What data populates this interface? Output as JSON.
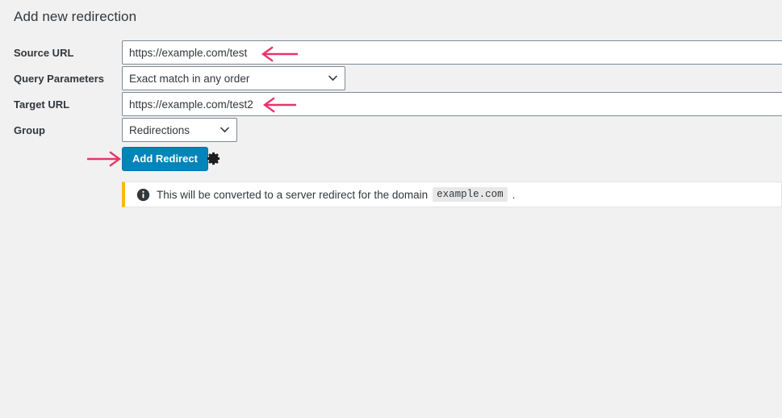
{
  "page": {
    "title": "Add new redirection",
    "background_color": "#f1f1f1"
  },
  "form": {
    "rows": [
      {
        "label": "Source URL",
        "type": "text",
        "value": "https://example.com/test",
        "placeholder": ""
      },
      {
        "label": "Query Parameters",
        "type": "select",
        "value": "Exact match in any order"
      },
      {
        "label": "Target URL",
        "type": "text",
        "value": "https://example.com/test2",
        "placeholder": ""
      },
      {
        "label": "Group",
        "type": "select",
        "value": "Redirections"
      }
    ],
    "submit": {
      "label": "Add Redirect",
      "color": "#0085ba",
      "gear_icon": "gear-icon"
    }
  },
  "notice": {
    "icon": "info-icon",
    "text_before": "This will be converted to a server redirect for the domain",
    "code": "example.com",
    "text_after": ".",
    "accent_color": "#ffb900"
  },
  "annotations": {
    "color": "#e8346b",
    "arrows": [
      {
        "name": "arrow-to-source-url",
        "direction": "left"
      },
      {
        "name": "arrow-to-target-url",
        "direction": "left"
      },
      {
        "name": "arrow-to-add-redirect-button",
        "direction": "right"
      }
    ]
  }
}
